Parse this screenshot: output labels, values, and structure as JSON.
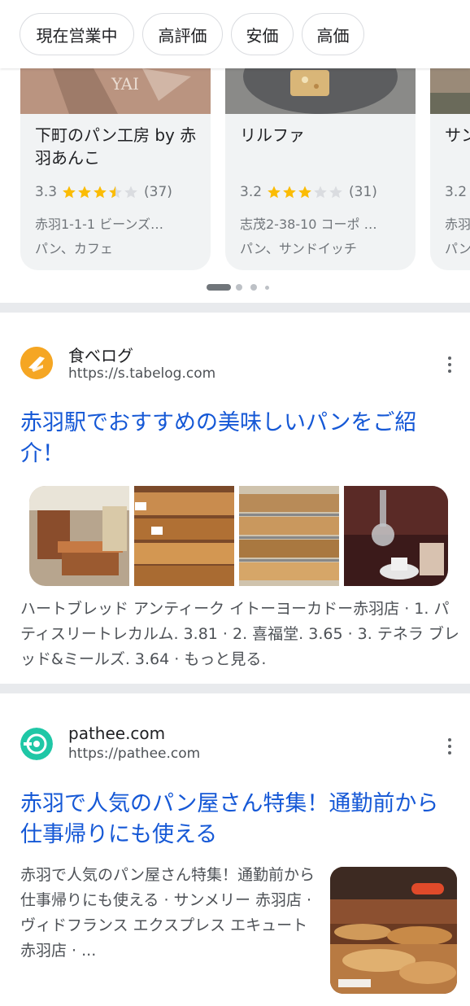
{
  "chips": [
    "現在営業中",
    "高評価",
    "安価",
    "高価"
  ],
  "places": [
    {
      "title": "下町のパン工房 by 赤羽あんこ",
      "rating": "3.3",
      "rating_value": 3.3,
      "reviews": "(37)",
      "address": "赤羽1-1-1 ビーンズ…",
      "category": "パン、カフェ"
    },
    {
      "title": "リルファ",
      "rating": "3.2",
      "rating_value": 3.2,
      "reviews": "(31)",
      "address": "志茂2-38-10 コーポ …",
      "category": "パン、サンドイッチ"
    },
    {
      "title": "サン",
      "rating": "3.2",
      "rating_value": 3.2,
      "reviews": "",
      "address": "赤羽",
      "category": "パン"
    }
  ],
  "results": [
    {
      "site_name": "食べログ",
      "url": "https://s.tabelog.com",
      "title": "赤羽駅でおすすめの美味しいパンをご紹介！",
      "snippet": "ハートブレッド アンティーク イトーヨーカドー赤羽店 · 1. パティスリートレカルム. 3.81 · 2. 喜福堂. 3.65 · 3. テネラ ブレッド&ミールズ. 3.64 · もっと見る."
    },
    {
      "site_name": "pathee.com",
      "url": "https://pathee.com",
      "title": "赤羽で人気のパン屋さん特集！通勤前から仕事帰りにも使える",
      "snippet": "赤羽で人気のパン屋さん特集！通勤前から仕事帰りにも使える · サンメリー 赤羽店 · ヴィドフランス エクスプレス エキュート赤羽店 · ..."
    }
  ],
  "colors": {
    "link": "#1558d6",
    "star": "#fbbc04",
    "star_empty": "#dadce0",
    "tabelog": "#f5a623",
    "pathee": "#1fc7a6"
  }
}
